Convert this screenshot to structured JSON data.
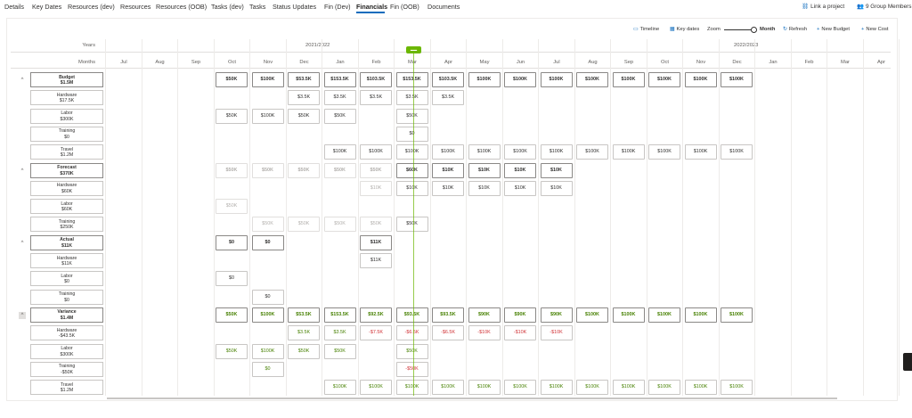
{
  "nav": {
    "tabs": [
      "Details",
      "Key Dates",
      "Resources (dev)",
      "Resources",
      "Resources (OOB)",
      "Tasks (dev)",
      "Tasks",
      "Status Updates",
      "Fin (Dev)",
      "Financials",
      "Fin (OOB)",
      "Documents"
    ],
    "active_tab": "Financials",
    "link_project": "Link a project",
    "group_members": "9 Group Members"
  },
  "toolbar": {
    "timeline": "Timeline",
    "key_dates": "Key dates",
    "zoom": "Zoom",
    "zoom_level": "Month",
    "refresh": "Refresh",
    "new_budget": "New Budget",
    "new_cost": "New Cost"
  },
  "header": {
    "years_label": "Years",
    "months_label": "Months",
    "years": [
      "2021/2022",
      "2022/2023"
    ],
    "months": [
      "Jul",
      "Aug",
      "Sep",
      "Oct",
      "Nov",
      "Dec",
      "Jan",
      "Feb",
      "Mar",
      "Apr",
      "May",
      "Jun",
      "Jul",
      "Aug",
      "Sep",
      "Oct",
      "Nov",
      "Dec",
      "Jan",
      "Feb",
      "Mar",
      "Apr"
    ]
  },
  "rows": [
    {
      "group": true,
      "name": "Budget",
      "total": "$1.5M",
      "collapse": "^",
      "cells": [
        null,
        null,
        null,
        "$50K",
        "$100K",
        "$53.5K",
        "$153.5K",
        "$103.5K",
        "$153.5K",
        "$103.5K",
        "$100K",
        "$100K",
        "$100K",
        "$100K",
        "$100K",
        "$100K",
        "$100K",
        "$100K",
        null,
        null,
        null,
        null
      ]
    },
    {
      "group": false,
      "name": "Hardware",
      "total": "$17.5K",
      "cells": [
        null,
        null,
        null,
        null,
        null,
        "$3.5K",
        "$3.5K",
        "$3.5K",
        "$3.5K",
        "$3.5K",
        null,
        null,
        null,
        null,
        null,
        null,
        null,
        null,
        null,
        null,
        null,
        null
      ]
    },
    {
      "group": false,
      "name": "Labor",
      "total": "$300K",
      "cells": [
        null,
        null,
        null,
        "$50K",
        "$100K",
        "$50K",
        "$50K",
        null,
        "$50K",
        null,
        null,
        null,
        null,
        null,
        null,
        null,
        null,
        null,
        null,
        null,
        null,
        null
      ]
    },
    {
      "group": false,
      "name": "Training",
      "total": "$0",
      "cells": [
        null,
        null,
        null,
        null,
        null,
        null,
        null,
        null,
        "$0",
        null,
        null,
        null,
        null,
        null,
        null,
        null,
        null,
        null,
        null,
        null,
        null,
        null
      ]
    },
    {
      "group": false,
      "name": "Travel",
      "total": "$1.2M",
      "cells": [
        null,
        null,
        null,
        null,
        null,
        null,
        "$100K",
        "$100K",
        "$100K",
        "$100K",
        "$100K",
        "$100K",
        "$100K",
        "$100K",
        "$100K",
        "$100K",
        "$100K",
        "$100K",
        null,
        null,
        null,
        null
      ]
    },
    {
      "group": true,
      "name": "Forecast",
      "total": "$370K",
      "collapse": "^",
      "cells": [
        null,
        null,
        null,
        "$50K",
        "$50K",
        "$50K",
        "$50K",
        "$50K",
        "$60K",
        "$10K",
        "$10K",
        "$10K",
        "$10K",
        null,
        null,
        null,
        null,
        null,
        null,
        null,
        null,
        null
      ],
      "faded_before": 8
    },
    {
      "group": false,
      "name": "Hardware",
      "total": "$60K",
      "cells": [
        null,
        null,
        null,
        null,
        null,
        null,
        null,
        "$10K",
        "$10K",
        "$10K",
        "$10K",
        "$10K",
        "$10K",
        null,
        null,
        null,
        null,
        null,
        null,
        null,
        null,
        null
      ],
      "faded_before": 8
    },
    {
      "group": false,
      "name": "Labor",
      "total": "$60K",
      "cells": [
        null,
        null,
        null,
        "$50K",
        null,
        null,
        null,
        null,
        null,
        null,
        null,
        null,
        null,
        null,
        null,
        null,
        null,
        null,
        null,
        null,
        null,
        null
      ],
      "faded_before": 8
    },
    {
      "group": false,
      "name": "Training",
      "total": "$250K",
      "cells": [
        null,
        null,
        null,
        null,
        "$50K",
        "$50K",
        "$50K",
        "$50K",
        "$50K",
        null,
        null,
        null,
        null,
        null,
        null,
        null,
        null,
        null,
        null,
        null,
        null,
        null
      ],
      "faded_before": 8
    },
    {
      "group": true,
      "name": "Actual",
      "total": "$11K",
      "collapse": "^",
      "cells": [
        null,
        null,
        null,
        "$0",
        "$0",
        null,
        null,
        "$11K",
        null,
        null,
        null,
        null,
        null,
        null,
        null,
        null,
        null,
        null,
        null,
        null,
        null,
        null
      ]
    },
    {
      "group": false,
      "name": "Hardware",
      "total": "$11K",
      "cells": [
        null,
        null,
        null,
        null,
        null,
        null,
        null,
        "$11K",
        null,
        null,
        null,
        null,
        null,
        null,
        null,
        null,
        null,
        null,
        null,
        null,
        null,
        null
      ]
    },
    {
      "group": false,
      "name": "Labor",
      "total": "$0",
      "cells": [
        null,
        null,
        null,
        "$0",
        null,
        null,
        null,
        null,
        null,
        null,
        null,
        null,
        null,
        null,
        null,
        null,
        null,
        null,
        null,
        null,
        null,
        null
      ]
    },
    {
      "group": false,
      "name": "Training",
      "total": "$0",
      "cells": [
        null,
        null,
        null,
        null,
        "$0",
        null,
        null,
        null,
        null,
        null,
        null,
        null,
        null,
        null,
        null,
        null,
        null,
        null,
        null,
        null,
        null,
        null
      ]
    },
    {
      "group": true,
      "name": "Variance",
      "total": "$1.4M",
      "collapse": "^",
      "boxed": true,
      "cells": [
        null,
        null,
        null,
        "$50K",
        "$100K",
        "$53.5K",
        "$153.5K",
        "$92.5K",
        "$93.5K",
        "$93.5K",
        "$90K",
        "$90K",
        "$90K",
        "$100K",
        "$100K",
        "$100K",
        "$100K",
        "$100K",
        null,
        null,
        null,
        null
      ],
      "variance": true
    },
    {
      "group": false,
      "name": "Hardware",
      "total": "-$43.5K",
      "cells": [
        null,
        null,
        null,
        null,
        null,
        "$3.5K",
        "$3.5K",
        "-$7.5K",
        "-$6.5K",
        "-$6.5K",
        "-$10K",
        "-$10K",
        "-$10K",
        null,
        null,
        null,
        null,
        null,
        null,
        null,
        null,
        null
      ],
      "variance": true
    },
    {
      "group": false,
      "name": "Labor",
      "total": "$300K",
      "cells": [
        null,
        null,
        null,
        "$50K",
        "$100K",
        "$50K",
        "$50K",
        null,
        "$50K",
        null,
        null,
        null,
        null,
        null,
        null,
        null,
        null,
        null,
        null,
        null,
        null,
        null
      ],
      "variance": true
    },
    {
      "group": false,
      "name": "Training",
      "total": "-$50K",
      "cells": [
        null,
        null,
        null,
        null,
        "$0",
        null,
        null,
        null,
        "-$50K",
        null,
        null,
        null,
        null,
        null,
        null,
        null,
        null,
        null,
        null,
        null,
        null,
        null
      ],
      "variance": true
    },
    {
      "group": false,
      "name": "Travel",
      "total": "$1.2M",
      "cells": [
        null,
        null,
        null,
        null,
        null,
        null,
        "$100K",
        "$100K",
        "$100K",
        "$100K",
        "$100K",
        "$100K",
        "$100K",
        "$100K",
        "$100K",
        "$100K",
        "$100K",
        "$100K",
        null,
        null,
        null,
        null
      ],
      "variance": true
    }
  ],
  "colors": {
    "accent": "#0f6cbd",
    "positive": "#498205",
    "negative": "#d13438",
    "today": "#6bb700"
  }
}
